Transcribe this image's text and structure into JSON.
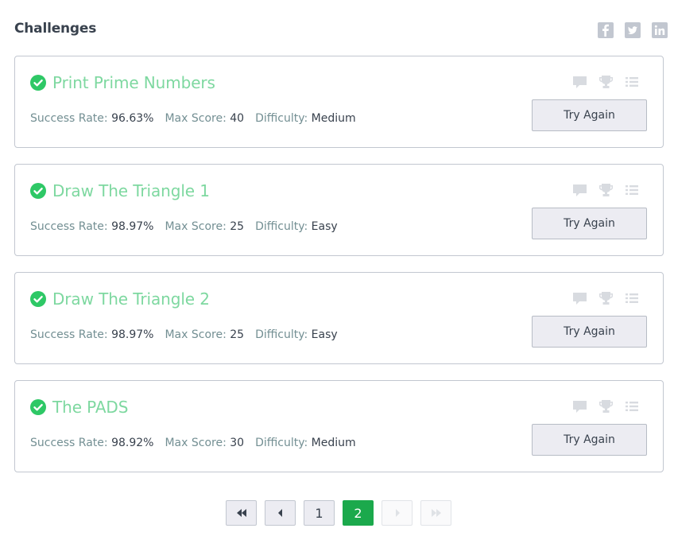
{
  "header": {
    "title": "Challenges",
    "social": [
      {
        "name": "facebook-icon"
      },
      {
        "name": "twitter-icon"
      },
      {
        "name": "linkedin-icon"
      }
    ]
  },
  "labels": {
    "success_rate": "Success Rate:",
    "max_score": "Max Score:",
    "difficulty": "Difficulty:",
    "try_again": "Try Again"
  },
  "challenges": [
    {
      "title": "Print Prime Numbers",
      "status": "solved",
      "success_rate": "96.63%",
      "max_score": "40",
      "difficulty": "Medium"
    },
    {
      "title": "Draw The Triangle 1",
      "status": "solved",
      "success_rate": "98.97%",
      "max_score": "25",
      "difficulty": "Easy"
    },
    {
      "title": "Draw The Triangle 2",
      "status": "solved",
      "success_rate": "98.97%",
      "max_score": "25",
      "difficulty": "Easy"
    },
    {
      "title": "The PADS",
      "status": "solved",
      "success_rate": "98.92%",
      "max_score": "30",
      "difficulty": "Medium"
    }
  ],
  "pagination": {
    "pages": [
      "1",
      "2"
    ],
    "current_page": "2"
  },
  "colors": {
    "accent_green": "#1ba94c",
    "solved_title": "#7ed8a0",
    "check_icon": "#2ec866",
    "icon_gray": "#d8dbe0"
  }
}
